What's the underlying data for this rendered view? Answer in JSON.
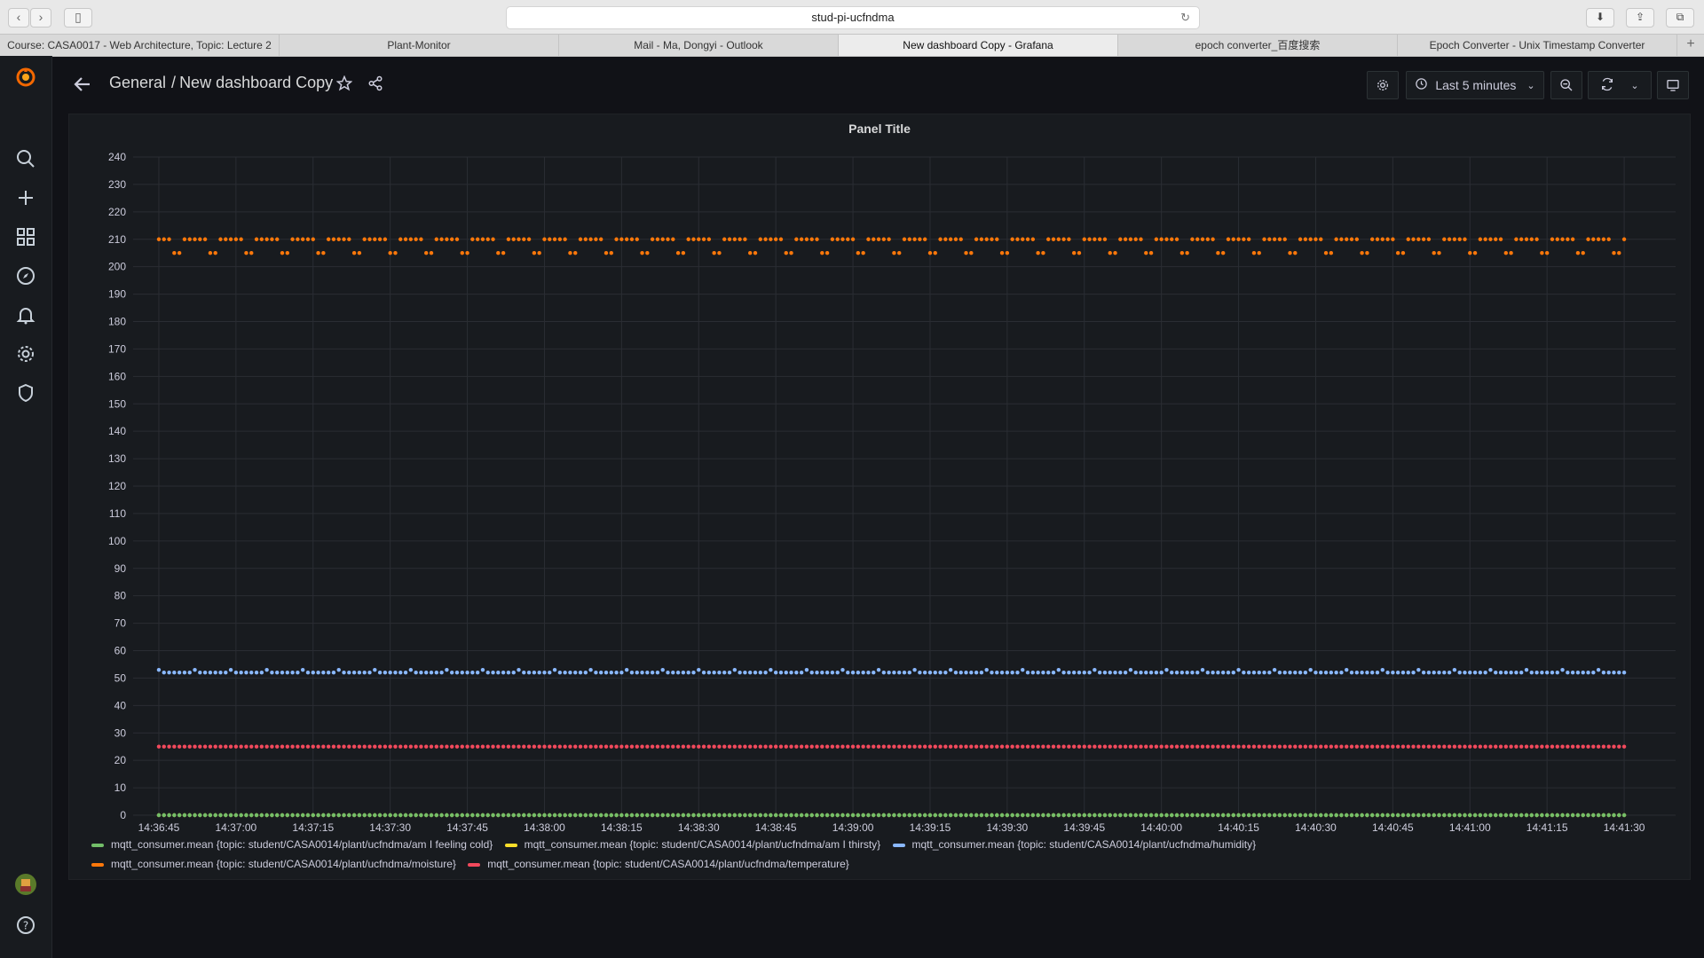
{
  "browser": {
    "url": "stud-pi-ucfndma",
    "tabs": [
      {
        "label": "Course: CASA0017 - Web Architecture, Topic: Lecture 2",
        "active": false
      },
      {
        "label": "Plant-Monitor",
        "active": false
      },
      {
        "label": "Mail - Ma, Dongyi - Outlook",
        "active": false
      },
      {
        "label": "New dashboard Copy - Grafana",
        "active": true
      },
      {
        "label": "epoch converter_百度搜索",
        "active": false
      },
      {
        "label": "Epoch Converter - Unix Timestamp Converter",
        "active": false
      }
    ]
  },
  "header": {
    "folder": "General",
    "separator": "/",
    "dashboard": "New dashboard Copy",
    "time_range": "Last 5 minutes"
  },
  "nav_icons": [
    "grafana-logo-icon",
    "search-icon",
    "plus-icon",
    "dashboards-icon",
    "explore-icon",
    "alert-bell-icon",
    "gear-icon",
    "shield-icon",
    "avatar-icon",
    "help-icon"
  ],
  "panel": {
    "title": "Panel Title"
  },
  "chart_data": {
    "type": "scatter",
    "title": "Panel Title",
    "ylim": [
      0,
      240
    ],
    "y_ticks": [
      0,
      10,
      20,
      30,
      40,
      50,
      60,
      70,
      80,
      90,
      100,
      110,
      120,
      130,
      140,
      150,
      160,
      170,
      180,
      190,
      200,
      210,
      220,
      230,
      240
    ],
    "x_ticks": [
      "14:36:45",
      "14:37:00",
      "14:37:15",
      "14:37:30",
      "14:37:45",
      "14:38:00",
      "14:38:15",
      "14:38:30",
      "14:38:45",
      "14:39:00",
      "14:39:15",
      "14:39:30",
      "14:39:45",
      "14:40:00",
      "14:40:15",
      "14:40:30",
      "14:40:45",
      "14:41:00",
      "14:41:15",
      "14:41:30"
    ],
    "x_range": [
      "14:36:40",
      "14:41:40"
    ],
    "grid": true,
    "legend_position": "bottom",
    "series": [
      {
        "name": "mqtt_consumer.mean {topic: student/CASA0014/plant/ucfndma/am I feeling cold}",
        "color": "#73bf69",
        "values": [
          0
        ]
      },
      {
        "name": "mqtt_consumer.mean {topic: student/CASA0014/plant/ucfndma/am I thirsty}",
        "color": "#fade2a",
        "values": [
          0
        ]
      },
      {
        "name": "mqtt_consumer.mean {topic: student/CASA0014/plant/ucfndma/humidity}",
        "color": "#8ab8ff",
        "values": [
          52,
          53
        ]
      },
      {
        "name": "mqtt_consumer.mean {topic: student/CASA0014/plant/ucfndma/moisture}",
        "color": "#ff780a",
        "values": [
          205,
          213
        ]
      },
      {
        "name": "mqtt_consumer.mean {topic: student/CASA0014/plant/ucfndma/temperature}",
        "color": "#f2495c",
        "values": [
          25
        ]
      }
    ]
  }
}
